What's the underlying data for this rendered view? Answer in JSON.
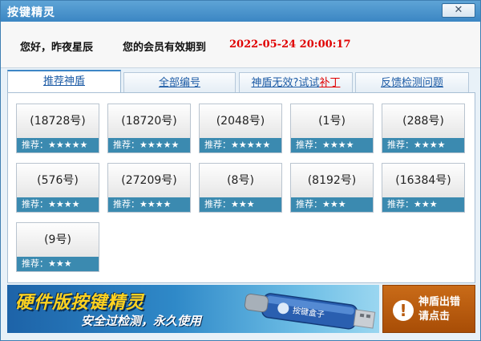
{
  "window": {
    "title": "按键精灵",
    "close_label": "✕"
  },
  "header": {
    "greeting": "您好，昨夜星辰",
    "member_label": "您的会员有效期到",
    "expire_date": "2022-05-24 20:00:17"
  },
  "tabs": [
    {
      "label": "推荐神盾",
      "active": true
    },
    {
      "label": "全部编号",
      "active": false
    },
    {
      "label_main": "神盾无效?试试",
      "label_red": "补丁",
      "active": false
    },
    {
      "label": "反馈检测问题",
      "active": false
    }
  ],
  "cards": [
    {
      "number": "(18728号)",
      "rec_label": "推荐：",
      "stars": "★★★★★"
    },
    {
      "number": "(18720号)",
      "rec_label": "推荐：",
      "stars": "★★★★★"
    },
    {
      "number": "(2048号)",
      "rec_label": "推荐：",
      "stars": "★★★★★"
    },
    {
      "number": "(1号)",
      "rec_label": "推荐：",
      "stars": "★★★★"
    },
    {
      "number": "(288号)",
      "rec_label": "推荐：",
      "stars": "★★★★"
    },
    {
      "number": "(576号)",
      "rec_label": "推荐：",
      "stars": "★★★★"
    },
    {
      "number": "(27209号)",
      "rec_label": "推荐：",
      "stars": "★★★★"
    },
    {
      "number": "(8号)",
      "rec_label": "推荐：",
      "stars": "★★★"
    },
    {
      "number": "(8192号)",
      "rec_label": "推荐：",
      "stars": "★★★"
    },
    {
      "number": "(16384号)",
      "rec_label": "推荐：",
      "stars": "★★★"
    },
    {
      "number": "(9号)",
      "rec_label": "推荐：",
      "stars": "★★★"
    }
  ],
  "banner": {
    "title": "硬件版按键精灵",
    "subtitle": "安全过检测，永久使用",
    "usb_label": "按键盒子"
  },
  "error_button": {
    "icon": "exclamation-icon",
    "line1": "神盾出错",
    "line2": "请点击"
  },
  "colors": {
    "accent": "#3d86c6",
    "star_bar": "#3b8ab0",
    "expire_red": "#e00000",
    "error_orange": "#b85a0e"
  }
}
